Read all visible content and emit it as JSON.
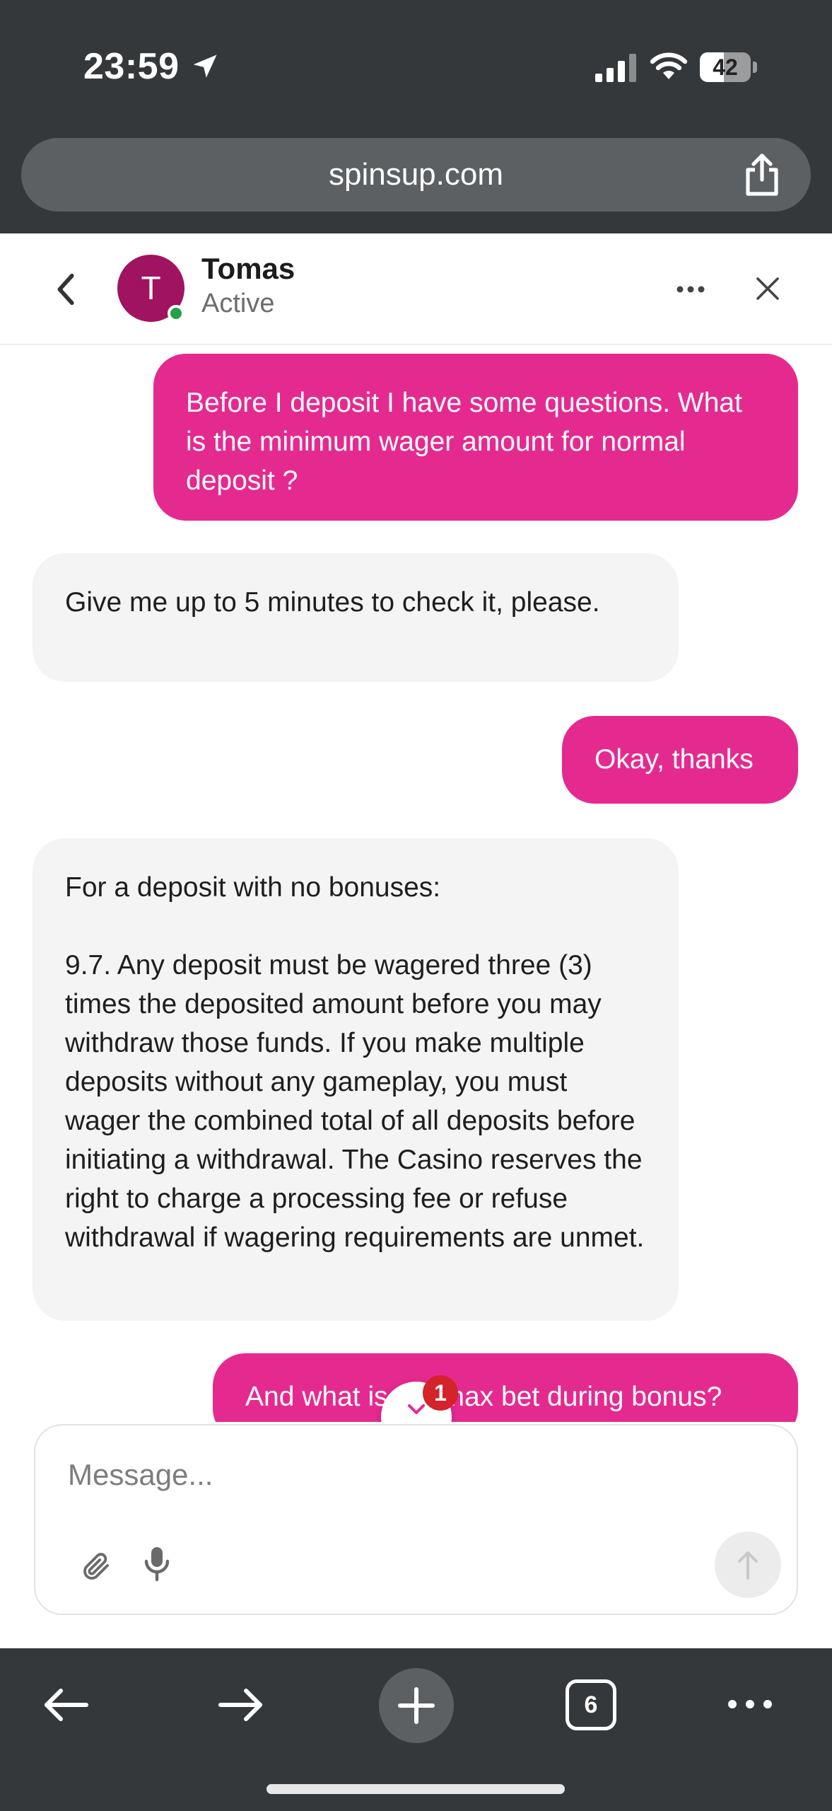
{
  "status_bar": {
    "time": "23:59",
    "battery": "42"
  },
  "browser": {
    "url": "spinsup.com",
    "tab_count": "6"
  },
  "chat_header": {
    "avatar_initial": "T",
    "agent_name": "Tomas",
    "agent_status": "Active"
  },
  "messages": [
    {
      "from": "user",
      "text": "Before I deposit I have some questions. What is the minimum wager amount for normal deposit ?"
    },
    {
      "from": "agent",
      "text": "Give me up to 5 minutes to check it, please."
    },
    {
      "from": "user",
      "text": "Okay, thanks"
    },
    {
      "from": "agent",
      "text": "For a deposit with no bonuses:\n\n9.7. Any deposit must be wagered three (3) times the deposited amount before you may withdraw those funds. If you make multiple deposits without any gameplay, you must wager the combined total of all deposits before initiating a withdrawal. The Casino reserves the right to charge a processing fee or refuse withdrawal if wagering requirements are unmet."
    },
    {
      "from": "user",
      "text": "And what is the max bet during bonus?"
    }
  ],
  "unread_badge": "1",
  "composer": {
    "placeholder": "Message..."
  },
  "colors": {
    "accent": "#e52a8f",
    "avatar": "#a01360",
    "online": "#22a347",
    "badge": "#d4232b"
  },
  "icons": [
    "location-arrow-icon",
    "signal-icon",
    "wifi-icon",
    "share-icon",
    "back-chevron-icon",
    "more-dots-icon",
    "close-icon",
    "chevron-down-icon",
    "paperclip-icon",
    "microphone-icon",
    "send-arrow-icon",
    "arrow-left-icon",
    "arrow-right-icon",
    "plus-icon",
    "tabs-icon"
  ]
}
